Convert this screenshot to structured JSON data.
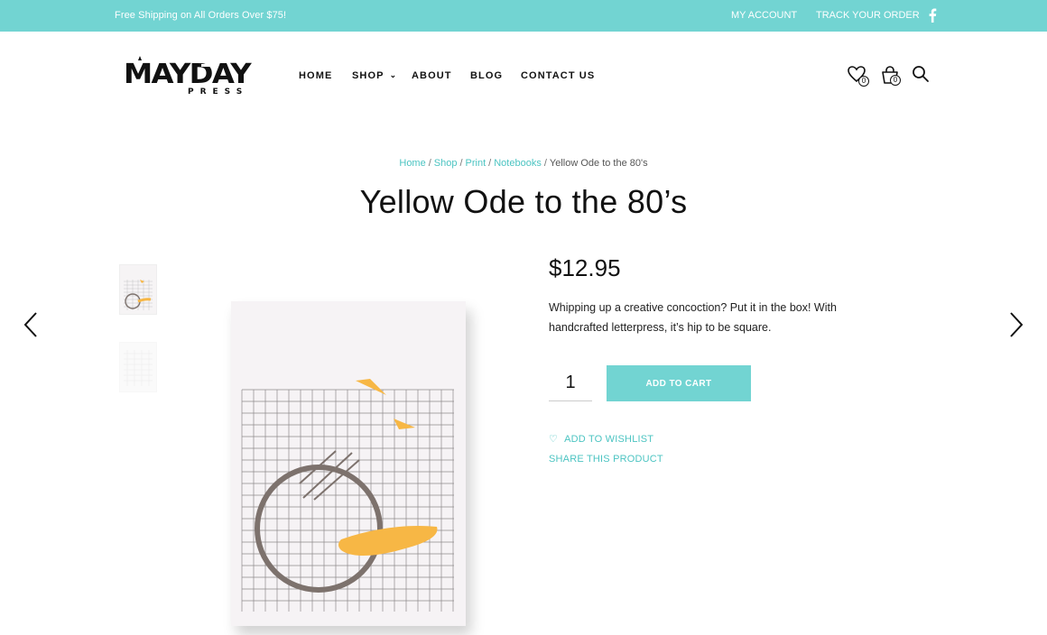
{
  "topbar": {
    "promo": "Free Shipping on All Orders Over $75!",
    "my_account": "MY ACCOUNT",
    "track_order": "TRACK YOUR ORDER",
    "social_icon": "facebook-icon"
  },
  "brand": {
    "logo_top": "MAYDAY",
    "logo_bottom": "PRESS"
  },
  "nav": {
    "items": [
      "HOME",
      "SHOP",
      "ABOUT",
      "BLOG",
      "CONTACT US"
    ]
  },
  "header_icons": {
    "wishlist_count": "0",
    "cart_count": "0",
    "icons": [
      "wishlist-icon",
      "cart-icon",
      "search-icon"
    ]
  },
  "breadcrumb": {
    "items": [
      "Home",
      "Shop",
      "Print",
      "Notebooks"
    ],
    "separator": "/",
    "current": "Yellow Ode to the 80's"
  },
  "product": {
    "title": "Yellow Ode to the 80’s",
    "price": "$12.95",
    "description": "Whipping up a creative concoction? Put it in the box! With handcrafted letterpress, it’s hip to be square.",
    "quantity": "1",
    "add_to_cart": "ADD TO CART",
    "add_to_wishlist": "ADD TO WISHLIST",
    "share": "SHARE THIS PRODUCT"
  },
  "colors": {
    "accent": "#72d4d2",
    "link": "#4cc4c2",
    "illustration_yellow": "#f7b745",
    "illustration_circle": "#7d726d"
  }
}
